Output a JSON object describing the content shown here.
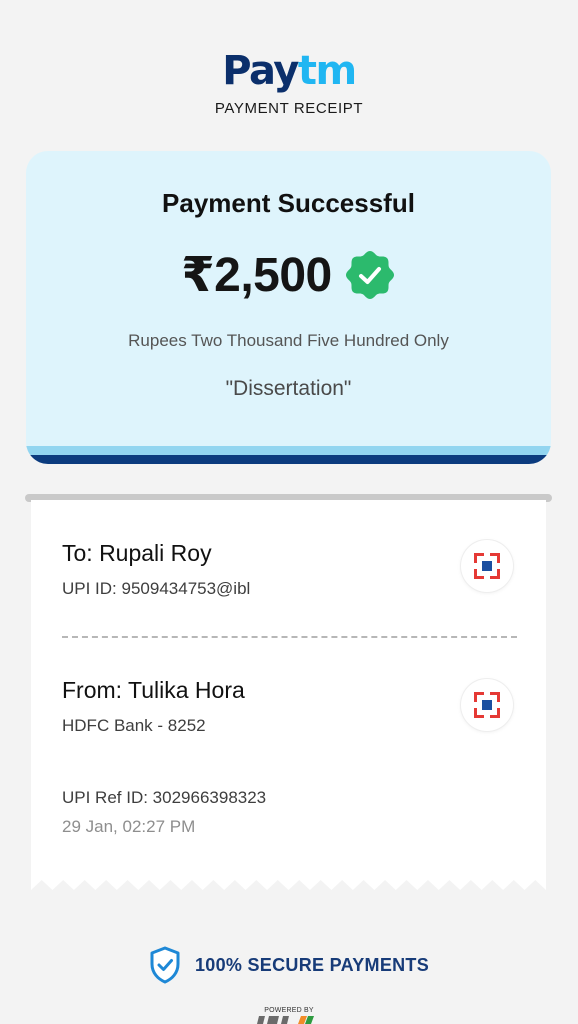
{
  "header": {
    "logo": {
      "part1": "Pay",
      "part2": "tm"
    },
    "subtitle": "PAYMENT RECEIPT"
  },
  "summary": {
    "title": "Payment Successful",
    "amount": "₹2,500",
    "amount_in_words": "Rupees Two Thousand Five Hundred Only",
    "note": "\"Dissertation\""
  },
  "recipient": {
    "name": "To:  Rupali Roy",
    "detail": "UPI ID: 9509434753@ibl"
  },
  "sender": {
    "name": "From: Tulika Hora",
    "detail": "HDFC Bank - 8252"
  },
  "transaction": {
    "ref": "UPI Ref ID: 302966398323",
    "datetime": "29 Jan, 02:27 PM"
  },
  "footer": {
    "secure_text": "100% SECURE PAYMENTS",
    "powered_by": "POWERED BY"
  },
  "colors": {
    "brand_dark": "#0b2f6b",
    "brand_light": "#20b6f2",
    "success_green": "#2cba6d",
    "card_bg": "#def4fc",
    "bank_red": "#e53935",
    "bank_blue": "#1b4fa0"
  },
  "icons": {
    "verified": "verified-check-icon",
    "bank": "hdfc-bank-icon",
    "secure": "shield-check-icon"
  }
}
